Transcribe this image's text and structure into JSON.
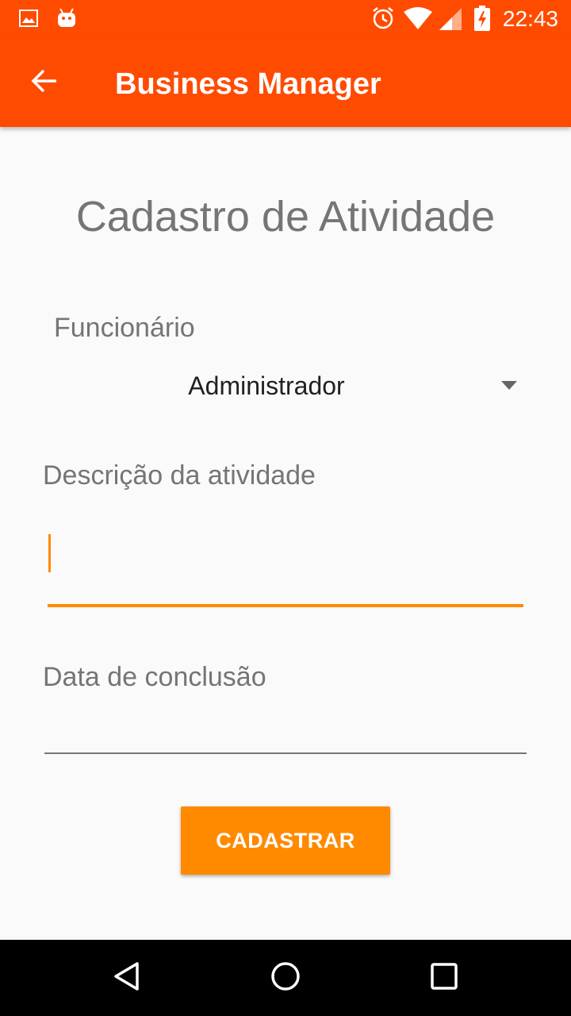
{
  "status_bar": {
    "time": "22:43",
    "left_icons": [
      "image-icon",
      "android-icon"
    ],
    "right_icons": [
      "alarm-icon",
      "wifi-icon",
      "signal-icon",
      "battery-charging-icon"
    ]
  },
  "app_bar": {
    "title": "Business Manager",
    "back_icon": "arrow-back-icon",
    "background_color": "#ff4b00"
  },
  "form": {
    "title": "Cadastro de Atividade",
    "employee_label": "Funcionário",
    "employee_selected": "Administrador",
    "description_label": "Descrição da atividade",
    "description_value": "",
    "date_label": "Data de conclusão",
    "date_value": "",
    "submit_label": "CADASTRAR",
    "accent_color": "#ff8a00"
  },
  "nav_bar": {
    "back_icon": "nav-back-icon",
    "home_icon": "nav-home-icon",
    "recents_icon": "nav-recents-icon"
  }
}
